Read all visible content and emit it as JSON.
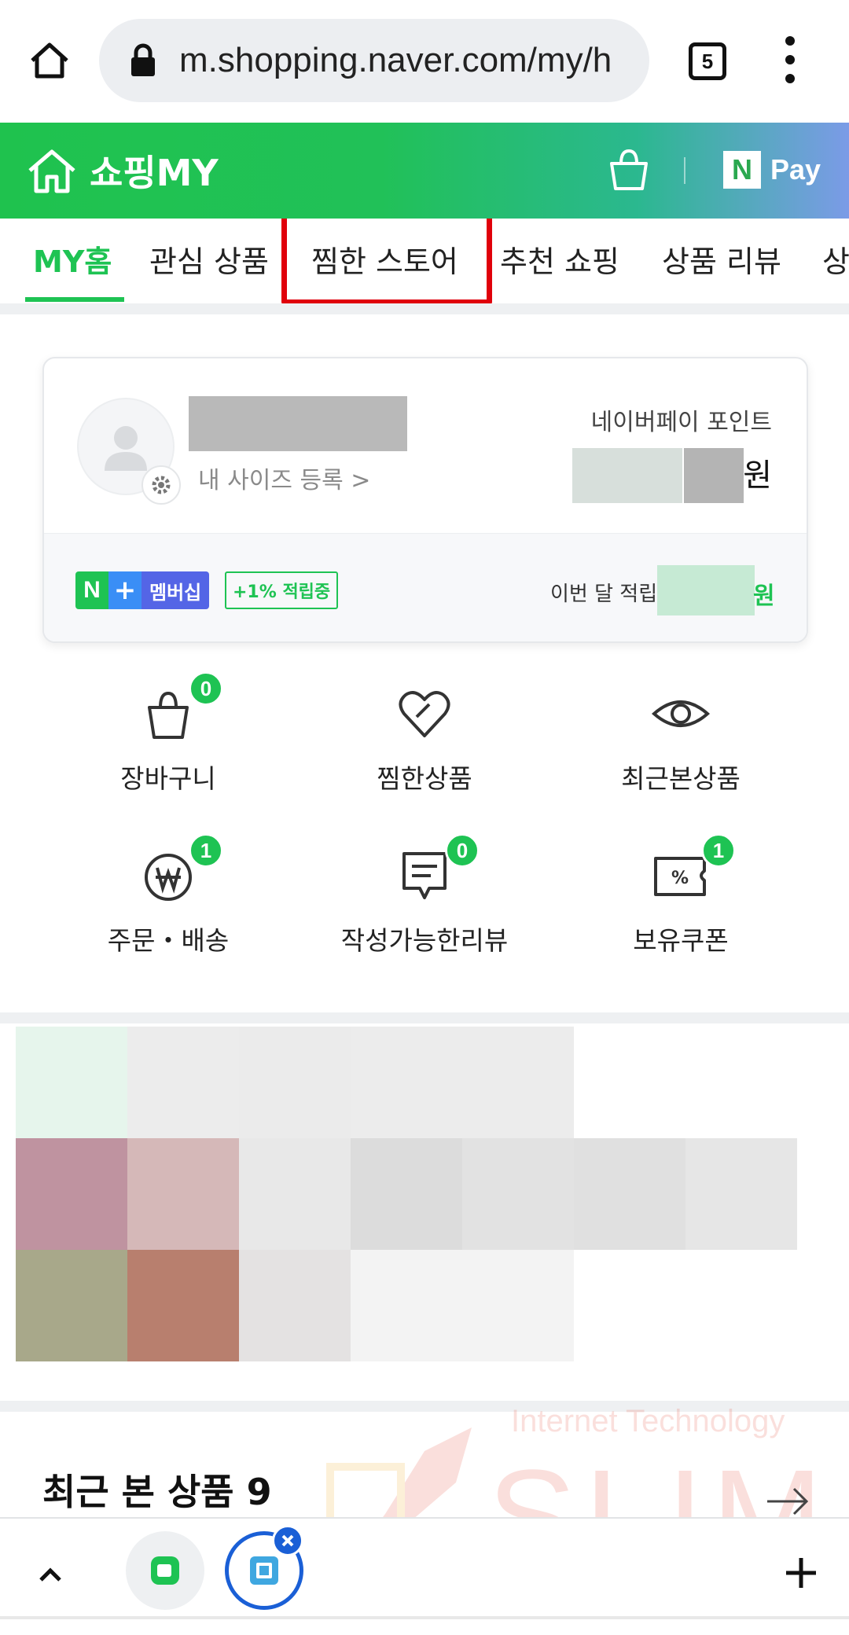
{
  "browser": {
    "url": "m.shopping.naver.com/my/h",
    "tab_count": "5",
    "home_icon": "home-icon",
    "lock_icon": "lock-icon",
    "menu_icon": "kebab-menu-icon"
  },
  "header": {
    "title": "쇼핑MY",
    "pay_n": "N",
    "pay_label": "Pay",
    "brand_color": "#1ec353"
  },
  "tabs": [
    {
      "label": "MY홈",
      "active": true
    },
    {
      "label": "관심 상품",
      "active": false
    },
    {
      "label": "찜한 스토어",
      "active": false,
      "highlighted": true
    },
    {
      "label": "추천 쇼핑",
      "active": false
    },
    {
      "label": "상품 리뷰",
      "active": false
    },
    {
      "label": "상",
      "active": false
    }
  ],
  "profile": {
    "size_link": "내 사이즈 등록 >",
    "point_label": "네이버페이 포인트",
    "point_unit": "원",
    "membership_n": "N",
    "membership_plus": "+",
    "membership_text": "멤버십",
    "accrual_badge": "+1% 적립중",
    "month_label": "이번 달 적립",
    "month_unit": "원"
  },
  "menu": [
    {
      "label": "장바구니",
      "badge": "0",
      "icon": "shopping-bag-icon"
    },
    {
      "label": "찜한상품",
      "badge": "",
      "icon": "heart-icon"
    },
    {
      "label": "최근본상품",
      "badge": "",
      "icon": "eye-icon"
    },
    {
      "label": "주문・배송",
      "badge": "1",
      "icon": "won-coin-icon"
    },
    {
      "label": "작성가능한리뷰",
      "badge": "0",
      "icon": "review-bubble-icon"
    },
    {
      "label": "보유쿠폰",
      "badge": "1",
      "icon": "coupon-icon"
    }
  ],
  "recent": {
    "title": "최근 본 상품 9"
  },
  "watermark": {
    "line1": "Internet Technology",
    "line2": "SLIM"
  }
}
